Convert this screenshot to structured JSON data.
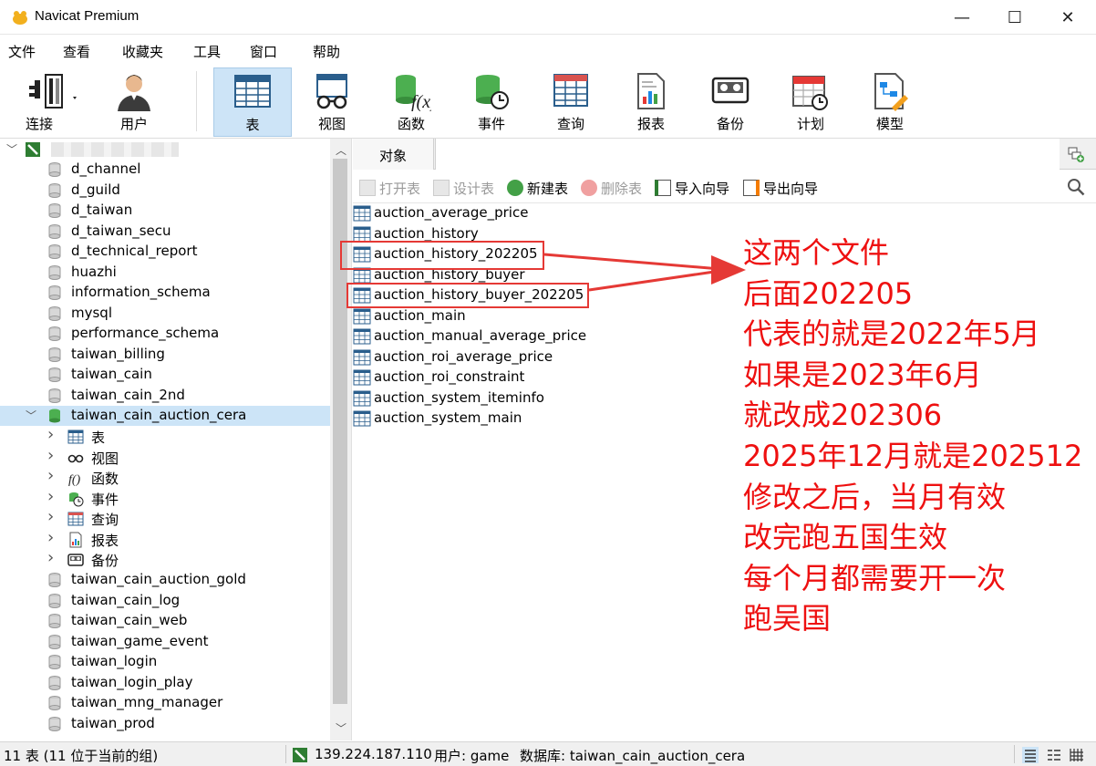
{
  "window": {
    "title": "Navicat Premium",
    "minimize": "—",
    "maximize": "☐",
    "close": "✕"
  },
  "menu": [
    "文件",
    "查看",
    "收藏夹",
    "工具",
    "窗口",
    "帮助"
  ],
  "toolbar": {
    "connect": "连接",
    "user": "用户",
    "table": "表",
    "view": "视图",
    "function": "函数",
    "event": "事件",
    "query": "查询",
    "report": "报表",
    "backup": "备份",
    "schedule": "计划",
    "model": "模型"
  },
  "sidebar": {
    "databases_top": [
      "d_channel",
      "d_guild",
      "d_taiwan",
      "d_taiwan_secu",
      "d_technical_report",
      "huazhi",
      "information_schema",
      "mysql",
      "performance_schema",
      "taiwan_billing",
      "taiwan_cain",
      "taiwan_cain_2nd"
    ],
    "selected_db": "taiwan_cain_auction_cera",
    "children": [
      "表",
      "视图",
      "函数",
      "事件",
      "查询",
      "报表",
      "备份"
    ],
    "databases_bottom": [
      "taiwan_cain_auction_gold",
      "taiwan_cain_log",
      "taiwan_cain_web",
      "taiwan_game_event",
      "taiwan_login",
      "taiwan_login_play",
      "taiwan_mng_manager",
      "taiwan_prod"
    ]
  },
  "tabs": {
    "objects": "对象"
  },
  "object_toolbar": {
    "open": "打开表",
    "design": "设计表",
    "new": "新建表",
    "delete": "删除表",
    "import": "导入向导",
    "export": "导出向导"
  },
  "tables": [
    "auction_average_price",
    "auction_history",
    "auction_history_202205",
    "auction_history_buyer",
    "auction_history_buyer_202205",
    "auction_main",
    "auction_manual_average_price",
    "auction_roi_average_price",
    "auction_roi_constraint",
    "auction_system_iteminfo",
    "auction_system_main"
  ],
  "annotation": [
    "这两个文件",
    "后面202205",
    "代表的就是2022年5月",
    "如果是2023年6月",
    "就改成202306",
    "2025年12月就是202512",
    "修改之后，当月有效",
    "改完跑五国生效",
    "每个月都需要开一次",
    "跑吴国"
  ],
  "status": {
    "count": "11 表 (11 位于当前的组)",
    "host": "139.224.187.110",
    "user": "用户: game",
    "database": "数据库: taiwan_cain_auction_cera"
  },
  "colors": {
    "accent": "#0078d7",
    "selected": "#cce4f7",
    "annotation": "#ee1010"
  }
}
